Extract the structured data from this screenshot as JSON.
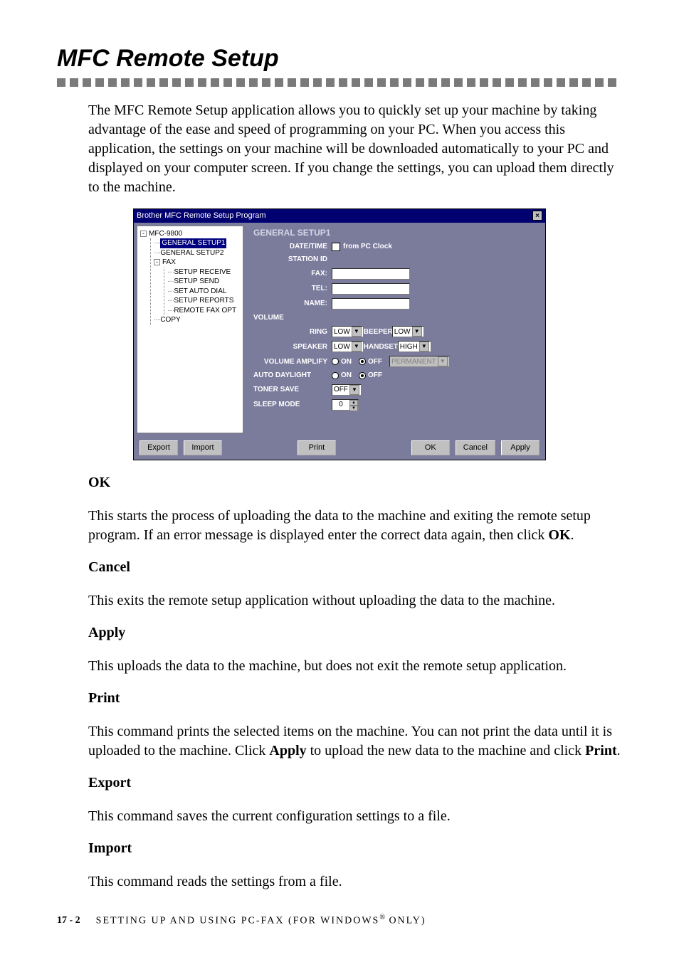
{
  "page_title": "MFC Remote Setup",
  "intro_paragraph": "The MFC Remote Setup application allows you to quickly set up your machine by taking advantage of the ease and speed of programming on your PC. When you access this application, the settings on your machine will be downloaded automatically to your PC and displayed on your computer screen. If you change the settings, you can upload them directly to the machine.",
  "app": {
    "title": "Brother MFC Remote Setup Program",
    "tree": {
      "root": "MFC-9800",
      "general1": "GENERAL SETUP1",
      "general2": "GENERAL SETUP2",
      "fax": "FAX",
      "fax_children": {
        "receive": "SETUP RECEIVE",
        "send": "SETUP SEND",
        "auto": "SET AUTO DIAL",
        "reports": "SETUP REPORTS",
        "remote": "REMOTE FAX OPT"
      },
      "copy": "COPY"
    },
    "panel": {
      "heading": "GENERAL SETUP1",
      "date_time": "DATE/TIME",
      "from_pc_clock": "from PC Clock",
      "station_id": "STATION ID",
      "fax_label": "FAX:",
      "tel_label": "TEL:",
      "name_label": "NAME:",
      "volume": "VOLUME",
      "ring": "RING",
      "ring_val": "LOW",
      "beeper": "BEEPER",
      "beeper_val": "LOW",
      "speaker": "SPEAKER",
      "speaker_val": "LOW",
      "handset": "HANDSET",
      "handset_val": "HIGH",
      "vol_amp": "VOLUME AMPLIFY",
      "on_label": "ON",
      "off_label": "OFF",
      "permanent": "PERMANENT",
      "auto_daylight": "AUTO DAYLIGHT",
      "toner_save": "TONER SAVE",
      "toner_val": "OFF",
      "sleep_mode": "SLEEP MODE",
      "sleep_val": "0"
    },
    "buttons": {
      "export": "Export",
      "import": "Import",
      "print": "Print",
      "ok": "OK",
      "cancel": "Cancel",
      "apply": "Apply"
    }
  },
  "sections": {
    "ok_h": "OK",
    "ok_p_a": "This starts the process of uploading the data to the machine and exiting the remote setup program.  If an error message is displayed enter the correct data again, then click ",
    "ok_p_b": "OK",
    "ok_p_c": ".",
    "cancel_h": "Cancel",
    "cancel_p": "This exits the remote setup application without uploading the data to the machine.",
    "apply_h": "Apply",
    "apply_p": "This uploads the data to the machine, but does not exit the remote setup application.",
    "print_h": "Print",
    "print_p_a": "This command prints the selected items on the machine.   You can not print the data until it is uploaded to the machine.  Click ",
    "print_p_b": "Apply",
    "print_p_c": " to upload the new data to the machine and click ",
    "print_p_d": "Print",
    "print_p_e": ".",
    "export_h": "Export",
    "export_p": "This command saves the current configuration settings to a file.",
    "import_h": "Import",
    "import_p": "This command reads the settings from a file."
  },
  "footer": {
    "page_num": "17 - 2",
    "chapter_a": "SETTING UP AND USING PC-FAX (FOR WINDOWS",
    "reg": "®",
    "chapter_b": " ONLY)"
  }
}
